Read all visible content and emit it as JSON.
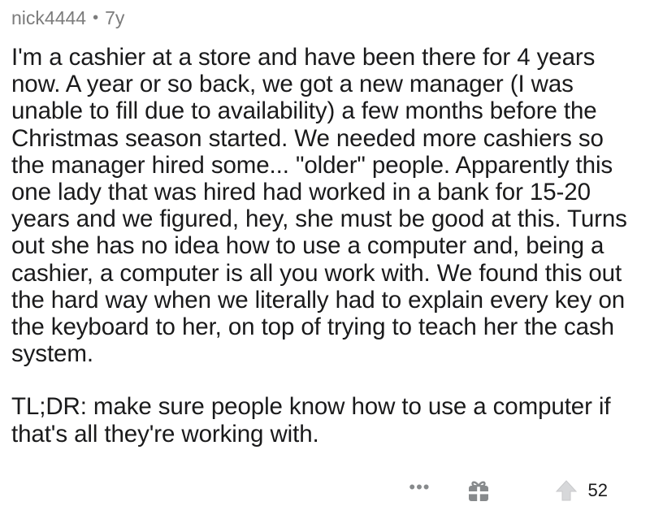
{
  "comment": {
    "author": "nick4444",
    "separator": "•",
    "age": "7y",
    "paragraphs": [
      "I'm a cashier at a store and have been there for 4 years now. A year or so back, we got a new manager (I was unable to fill due to availability) a few months before the Christmas season started. We needed more cashiers so the manager hired some... \"older\" people. Apparently this one lady that was hired had worked in a bank for 15-20 years and we figured, hey, she must be good at this. Turns out she has no idea how to use a computer and, being a cashier, a computer is all you work with. We found this out the hard way when we literally had to explain every key on the keyboard to her, on top of trying to teach her the cash system.",
      "TL;DR: make sure people know how to use a computer if that's all they're working with."
    ]
  },
  "actions": {
    "more_label": "•••",
    "award_icon": "gift-icon",
    "upvote_icon": "upvote-arrow-icon",
    "score": "52"
  },
  "colors": {
    "text": "#1a1a1b",
    "meta": "#7c7c7c",
    "icon": "#878a8c"
  }
}
